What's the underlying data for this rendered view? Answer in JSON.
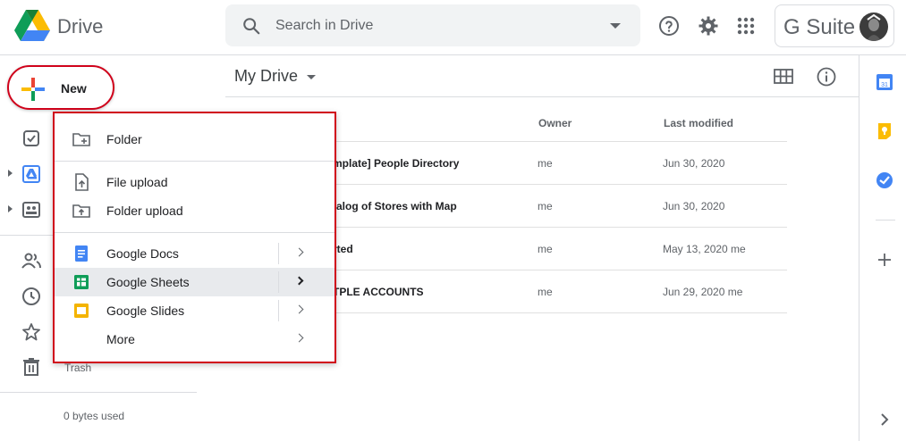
{
  "header": {
    "app_name": "Drive",
    "search_placeholder": "Search in Drive",
    "suite_label": "G Suite"
  },
  "new_button": {
    "label": "New"
  },
  "sidebar": {
    "trash_label": "Trash",
    "storage": "0 bytes used"
  },
  "main": {
    "title": "My Drive",
    "columns": {
      "owner": "Owner",
      "last_modified": "Last modified"
    },
    "rows": [
      {
        "name": "mplate] People Directory",
        "owner": "me",
        "modified": "Jun 30, 2020"
      },
      {
        "name": "talog of Stores with Map",
        "owner": "me",
        "modified": "Jun 30, 2020"
      },
      {
        "name": "rted",
        "owner": "me",
        "modified": "May 13, 2020 me"
      },
      {
        "name": "TPLE ACCOUNTS",
        "owner": "me",
        "modified": "Jun 29, 2020 me"
      }
    ]
  },
  "new_menu": {
    "folder": "Folder",
    "file_upload": "File upload",
    "folder_upload": "Folder upload",
    "docs": "Google Docs",
    "sheets": "Google Sheets",
    "slides": "Google Slides",
    "more": "More"
  },
  "colors": {
    "highlight_border": "#d0021b",
    "google_blue": "#4285f4",
    "google_green": "#0f9d58",
    "google_yellow": "#f4b400",
    "google_red": "#ea4335"
  }
}
